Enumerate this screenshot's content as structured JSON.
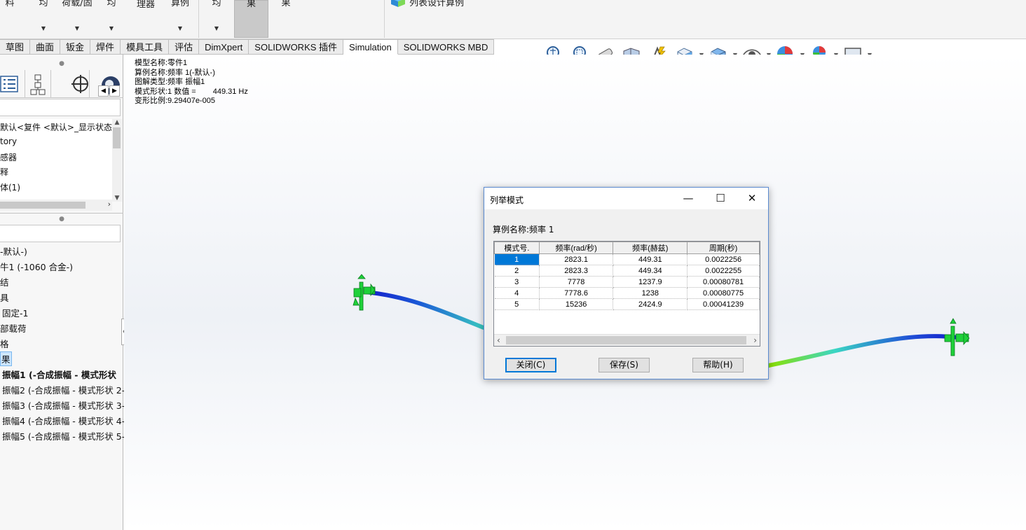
{
  "ribbon": {
    "items": [
      {
        "label": "料",
        "has_arrow": false
      },
      {
        "label": "均",
        "has_arrow": true
      },
      {
        "label": "荷载/固",
        "has_arrow": true
      },
      {
        "label": "均",
        "has_arrow": true
      },
      {
        "label": "理器",
        "has_arrow": true
      },
      {
        "label": "算例",
        "has_arrow": true
      },
      {
        "label": "均",
        "has_arrow": true
      },
      {
        "label": "果",
        "has_arrow": false
      },
      {
        "label": "果",
        "has_arrow": false
      }
    ],
    "right_label": "列表设计算例"
  },
  "tabs": [
    "草图",
    "曲面",
    "钣金",
    "焊件",
    "模具工具",
    "评估",
    "DimXpert",
    "SOLIDWORKS 插件",
    "Simulation",
    "SOLIDWORKS MBD"
  ],
  "active_tab": "Simulation",
  "view_toolbar": [
    {
      "icon": "zoom-to-fit-icon"
    },
    {
      "icon": "zoom-to-area-icon"
    },
    {
      "icon": "previous-view-icon"
    },
    {
      "icon": "section-view-icon"
    },
    {
      "icon": "dynamic-annotation-icon"
    },
    {
      "icon": "view-orientation-icon"
    },
    {
      "icon": "display-style-icon"
    },
    {
      "icon": "hide-show-items-icon"
    },
    {
      "icon": "edit-appearance-icon"
    },
    {
      "icon": "apply-scene-icon"
    },
    {
      "icon": "view-settings-icon"
    }
  ],
  "tree_top": {
    "items": [
      "默认<复件 <默认>_显示状态",
      "tory",
      "感器",
      "释",
      "体(1)"
    ]
  },
  "tree_bottom": {
    "items": [
      {
        "text": "-默认-)",
        "bold": false
      },
      {
        "text": "牛1 (-1060 合金-)",
        "bold": false
      },
      {
        "text": "结",
        "bold": false
      },
      {
        "text": "具",
        "bold": false
      },
      {
        "text": "固定-1",
        "bold": false
      },
      {
        "text": "部载荷",
        "bold": false
      },
      {
        "text": "格",
        "bold": false
      },
      {
        "text": "果",
        "bold": false
      },
      {
        "text": "振幅1 (-合成振幅 - 模式形状",
        "bold": true
      },
      {
        "text": "振幅2 (-合成振幅 - 模式形状 2-",
        "bold": false
      },
      {
        "text": "振幅3 (-合成振幅 - 模式形状 3-",
        "bold": false
      },
      {
        "text": "振幅4 (-合成振幅 - 模式形状 4-",
        "bold": false
      },
      {
        "text": "振幅5 (-合成振幅 - 模式形状 5-",
        "bold": false
      }
    ]
  },
  "overlay": {
    "model_name": "模型名称:零件1",
    "study_name": "算例名称:频率 1(-默认-)",
    "plot_type": "图解类型:频率 振幅1",
    "mode_shape_prefix": "模式形状:1  数值 =",
    "mode_shape_value": "449.31 Hz",
    "deformation": "变形比例:9.29407e-005"
  },
  "dialog": {
    "title": "列举模式",
    "case_label": "算例名称:频率 1",
    "columns": [
      "模式号.",
      "频率(rad/秒)",
      "频率(赫兹)",
      "周期(秒)"
    ],
    "rows": [
      [
        "1",
        "2823.1",
        "449.31",
        "0.0022256"
      ],
      [
        "2",
        "2823.3",
        "449.34",
        "0.0022255"
      ],
      [
        "3",
        "7778",
        "1237.9",
        "0.00080781"
      ],
      [
        "4",
        "7778.6",
        "1238",
        "0.00080775"
      ],
      [
        "5",
        "15236",
        "2424.9",
        "0.00041239"
      ]
    ],
    "buttons": {
      "close": "关闭(C)",
      "save": "保存(S)",
      "help": "帮助(H)"
    }
  },
  "colors": {
    "accent": "#0078d7",
    "beam_low": "#1a2bd8",
    "beam_mid": "#3bd6c4",
    "beam_high": "#7fe000",
    "fixture": "#1fd13a"
  }
}
